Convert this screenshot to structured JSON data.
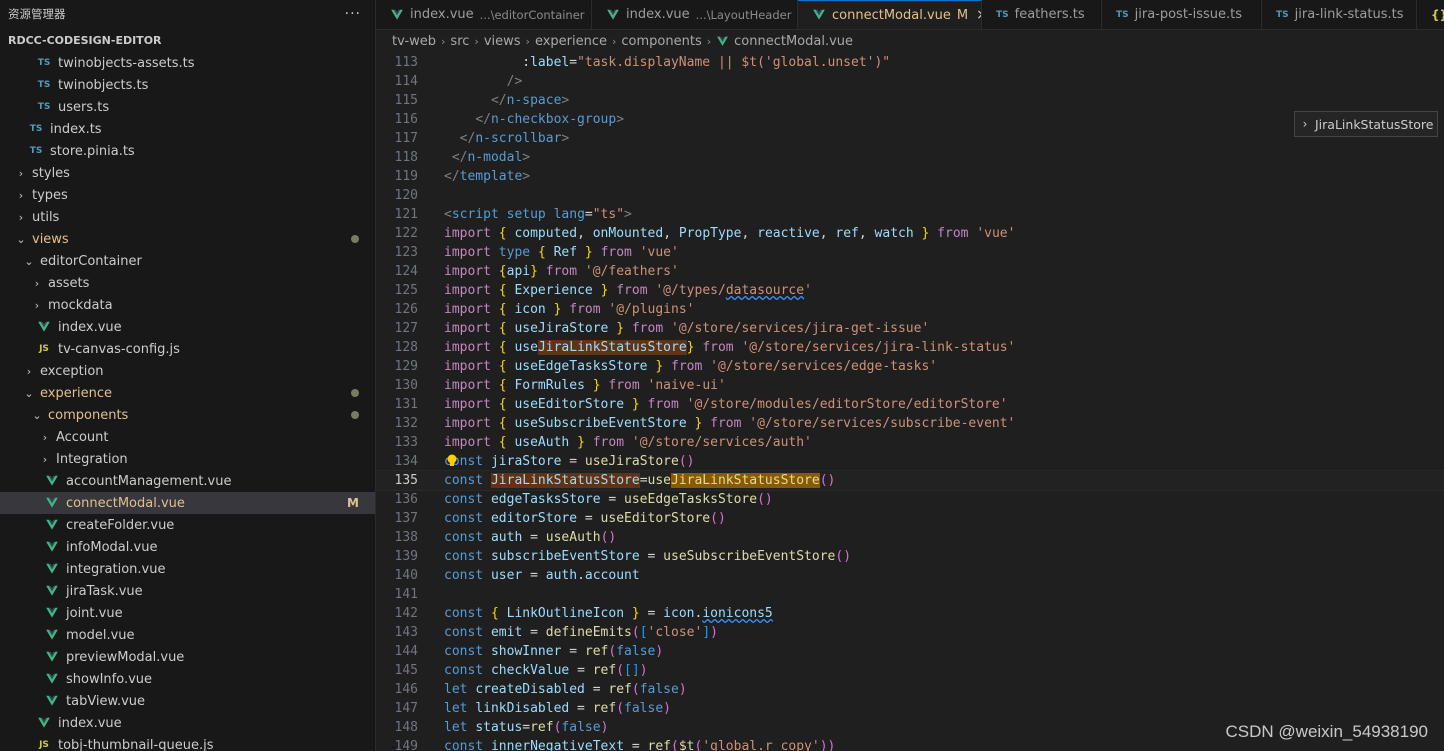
{
  "sidebar": {
    "header": "资源管理器",
    "more_label": "···",
    "section": "RDCC-CODESIGN-EDITOR",
    "items": [
      {
        "label": "twinobjects-assets.ts",
        "icon": "ts",
        "depth": 3,
        "chevron": "",
        "yellow": false
      },
      {
        "label": "twinobjects.ts",
        "icon": "ts",
        "depth": 3,
        "chevron": "",
        "yellow": false
      },
      {
        "label": "users.ts",
        "icon": "ts",
        "depth": 3,
        "chevron": "",
        "yellow": false
      },
      {
        "label": "index.ts",
        "icon": "ts",
        "depth": 2,
        "chevron": "",
        "yellow": false
      },
      {
        "label": "store.pinia.ts",
        "icon": "ts",
        "depth": 2,
        "chevron": "",
        "yellow": false
      },
      {
        "label": "styles",
        "icon": "",
        "depth": 1,
        "chevron": "›",
        "yellow": false
      },
      {
        "label": "types",
        "icon": "",
        "depth": 1,
        "chevron": "›",
        "yellow": false
      },
      {
        "label": "utils",
        "icon": "",
        "depth": 1,
        "chevron": "›",
        "yellow": false
      },
      {
        "label": "views",
        "icon": "",
        "depth": 1,
        "chevron": "⌄",
        "yellow": true,
        "dot": true
      },
      {
        "label": "editorContainer",
        "icon": "",
        "depth": 2,
        "chevron": "⌄",
        "yellow": false
      },
      {
        "label": "assets",
        "icon": "",
        "depth": 3,
        "chevron": "›",
        "yellow": false
      },
      {
        "label": "mockdata",
        "icon": "",
        "depth": 3,
        "chevron": "›",
        "yellow": false
      },
      {
        "label": "index.vue",
        "icon": "vue",
        "depth": 3,
        "chevron": "",
        "yellow": false
      },
      {
        "label": "tv-canvas-config.js",
        "icon": "js",
        "depth": 3,
        "chevron": "",
        "yellow": false
      },
      {
        "label": "exception",
        "icon": "",
        "depth": 2,
        "chevron": "›",
        "yellow": false
      },
      {
        "label": "experience",
        "icon": "",
        "depth": 2,
        "chevron": "⌄",
        "yellow": true,
        "dot": true
      },
      {
        "label": "components",
        "icon": "",
        "depth": 3,
        "chevron": "⌄",
        "yellow": true,
        "dot": true
      },
      {
        "label": "Account",
        "icon": "",
        "depth": 4,
        "chevron": "›",
        "yellow": false
      },
      {
        "label": "Integration",
        "icon": "",
        "depth": 4,
        "chevron": "›",
        "yellow": false
      },
      {
        "label": "accountManagement.vue",
        "icon": "vue",
        "depth": 4,
        "chevron": "",
        "yellow": false
      },
      {
        "label": "connectModal.vue",
        "icon": "vue",
        "depth": 4,
        "chevron": "",
        "yellow": true,
        "selected": true,
        "badge": "M"
      },
      {
        "label": "createFolder.vue",
        "icon": "vue",
        "depth": 4,
        "chevron": "",
        "yellow": false
      },
      {
        "label": "infoModal.vue",
        "icon": "vue",
        "depth": 4,
        "chevron": "",
        "yellow": false
      },
      {
        "label": "integration.vue",
        "icon": "vue",
        "depth": 4,
        "chevron": "",
        "yellow": false
      },
      {
        "label": "jiraTask.vue",
        "icon": "vue",
        "depth": 4,
        "chevron": "",
        "yellow": false
      },
      {
        "label": "joint.vue",
        "icon": "vue",
        "depth": 4,
        "chevron": "",
        "yellow": false
      },
      {
        "label": "model.vue",
        "icon": "vue",
        "depth": 4,
        "chevron": "",
        "yellow": false
      },
      {
        "label": "previewModal.vue",
        "icon": "vue",
        "depth": 4,
        "chevron": "",
        "yellow": false
      },
      {
        "label": "showInfo.vue",
        "icon": "vue",
        "depth": 4,
        "chevron": "",
        "yellow": false
      },
      {
        "label": "tabView.vue",
        "icon": "vue",
        "depth": 4,
        "chevron": "",
        "yellow": false
      },
      {
        "label": "index.vue",
        "icon": "vue",
        "depth": 3,
        "chevron": "",
        "yellow": false
      },
      {
        "label": "tobj-thumbnail-queue.js",
        "icon": "js",
        "depth": 3,
        "chevron": "",
        "yellow": false
      }
    ]
  },
  "tabs": [
    {
      "label": "index.vue",
      "desc": "...\\editorContainer",
      "icon": "vue",
      "active": false,
      "modified": "",
      "close": ""
    },
    {
      "label": "index.vue",
      "desc": "...\\LayoutHeader",
      "icon": "vue",
      "active": false,
      "modified": "",
      "close": ""
    },
    {
      "label": "connectModal.vue",
      "desc": "",
      "icon": "vue",
      "active": true,
      "modified": "M",
      "close": "×"
    },
    {
      "label": "feathers.ts",
      "desc": "",
      "icon": "ts",
      "active": false,
      "modified": "",
      "close": ""
    },
    {
      "label": "jira-post-issue.ts",
      "desc": "",
      "icon": "ts",
      "active": false,
      "modified": "",
      "close": ""
    },
    {
      "label": "jira-link-status.ts",
      "desc": "",
      "icon": "ts",
      "active": false,
      "modified": "",
      "close": ""
    },
    {
      "label": "",
      "desc": "",
      "icon": "json",
      "active": false,
      "modified": "",
      "close": ""
    }
  ],
  "breadcrumb": [
    "tv-web",
    "src",
    "views",
    "experience",
    "components",
    "connectModal.vue"
  ],
  "sticky_widget": {
    "label": "JiraLinkStatusStore"
  },
  "editor": {
    "current_line": 135,
    "lines": [
      {
        "n": 113,
        "t": "          :label=\"task.displayName || $t('global.unset')\""
      },
      {
        "n": 114,
        "t": "        />"
      },
      {
        "n": 115,
        "t": "      </n-space>"
      },
      {
        "n": 116,
        "t": "    </n-checkbox-group>"
      },
      {
        "n": 117,
        "t": "  </n-scrollbar>"
      },
      {
        "n": 118,
        "t": " </n-modal>"
      },
      {
        "n": 119,
        "t": "</template>"
      },
      {
        "n": 120,
        "t": ""
      },
      {
        "n": 121,
        "t": "<script setup lang=\"ts\">"
      },
      {
        "n": 122,
        "t": "import { computed, onMounted, PropType, reactive, ref, watch } from 'vue'"
      },
      {
        "n": 123,
        "t": "import type { Ref } from 'vue'"
      },
      {
        "n": 124,
        "t": "import {api} from '@/feathers'"
      },
      {
        "n": 125,
        "t": "import { Experience } from '@/types/datasource'"
      },
      {
        "n": 126,
        "t": "import { icon } from '@/plugins'"
      },
      {
        "n": 127,
        "t": "import { useJiraStore } from '@/store/services/jira-get-issue'"
      },
      {
        "n": 128,
        "t": "import { useJiraLinkStatusStore} from '@/store/services/jira-link-status'"
      },
      {
        "n": 129,
        "t": "import { useEdgeTasksStore } from '@/store/services/edge-tasks'"
      },
      {
        "n": 130,
        "t": "import { FormRules } from 'naive-ui'"
      },
      {
        "n": 131,
        "t": "import { useEditorStore } from '@/store/modules/editorStore/editorStore'"
      },
      {
        "n": 132,
        "t": "import { useSubscribeEventStore } from '@/store/services/subscribe-event'"
      },
      {
        "n": 133,
        "t": "import { useAuth } from '@/store/services/auth'"
      },
      {
        "n": 134,
        "t": "const jiraStore = useJiraStore()"
      },
      {
        "n": 135,
        "t": "const JiraLinkStatusStore=useJiraLinkStatusStore()"
      },
      {
        "n": 136,
        "t": "const edgeTasksStore = useEdgeTasksStore()"
      },
      {
        "n": 137,
        "t": "const editorStore = useEditorStore()"
      },
      {
        "n": 138,
        "t": "const auth = useAuth()"
      },
      {
        "n": 139,
        "t": "const subscribeEventStore = useSubscribeEventStore()"
      },
      {
        "n": 140,
        "t": "const user = auth.account"
      },
      {
        "n": 141,
        "t": ""
      },
      {
        "n": 142,
        "t": "const { LinkOutlineIcon } = icon.ionicons5"
      },
      {
        "n": 143,
        "t": "const emit = defineEmits(['close'])"
      },
      {
        "n": 144,
        "t": "const showInner = ref(false)"
      },
      {
        "n": 145,
        "t": "const checkValue = ref([])"
      },
      {
        "n": 146,
        "t": "let createDisabled = ref(false)"
      },
      {
        "n": 147,
        "t": "let linkDisabled = ref(false)"
      },
      {
        "n": 148,
        "t": "let status=ref(false)"
      },
      {
        "n": 149,
        "t": "const innerNegativeText = ref($t('global.r_copy'))"
      }
    ]
  },
  "watermark": "CSDN @weixin_54938190"
}
